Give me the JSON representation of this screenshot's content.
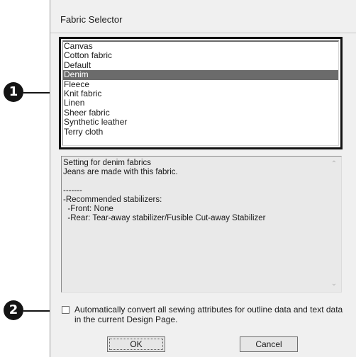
{
  "dialog": {
    "title": "Fabric Selector"
  },
  "fabric_list": {
    "items": [
      "Canvas",
      "Cotton fabric",
      "Default",
      "Denim",
      "Fleece",
      "Knit fabric",
      "Linen",
      "Sheer fabric",
      "Synthetic leather",
      "Terry cloth"
    ],
    "selected": "Denim"
  },
  "description": {
    "lines": [
      "Setting for denim fabrics",
      "Jeans are made with this fabric.",
      "",
      "-------",
      "-Recommended stabilizers:",
      "  -Front: None",
      "  -Rear: Tear-away stabilizer/Fusible Cut-away Stabilizer"
    ]
  },
  "checkbox": {
    "label": "Automatically convert all sewing attributes for outline data and text data in the current Design Page.",
    "checked": false
  },
  "buttons": {
    "ok_label": "OK",
    "cancel_label": "Cancel"
  },
  "callouts": {
    "one": "1",
    "two": "2"
  },
  "icons": {
    "scroll_up": "chevron-up-icon",
    "scroll_down": "chevron-down-icon"
  }
}
